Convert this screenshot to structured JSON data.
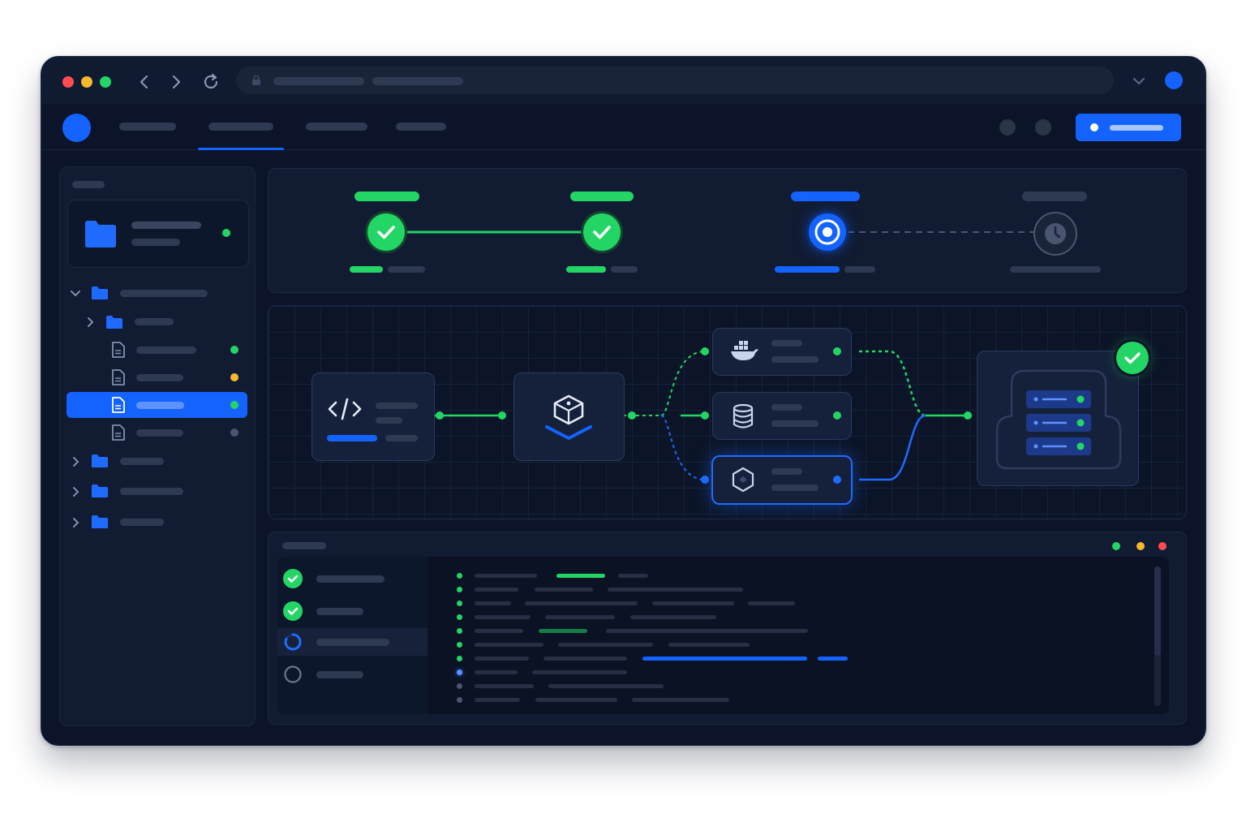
{
  "app": {
    "window_controls": [
      "close",
      "minimize",
      "maximize"
    ],
    "address_bar": {
      "icon": "lock-icon",
      "text": ""
    },
    "nav_tabs": [
      {
        "id": "nav-tab-1",
        "active": false
      },
      {
        "id": "nav-tab-2",
        "active": true
      },
      {
        "id": "nav-tab-3",
        "active": false
      },
      {
        "id": "nav-tab-4",
        "active": false
      }
    ],
    "primary_action": {
      "label": ""
    }
  },
  "sidebar": {
    "repo": {
      "name": "",
      "branch": "",
      "status": "ok"
    },
    "tree": [
      {
        "type": "folder",
        "expanded": true,
        "depth": 0
      },
      {
        "type": "folder",
        "expanded": false,
        "depth": 1
      },
      {
        "type": "file",
        "depth": 2,
        "status": "modified-green"
      },
      {
        "type": "file",
        "depth": 2,
        "status": "warning-yellow"
      },
      {
        "type": "file",
        "depth": 2,
        "status": "selected",
        "selected": true
      },
      {
        "type": "file",
        "depth": 2,
        "status": "neutral"
      },
      {
        "type": "folder",
        "expanded": false,
        "depth": 0
      },
      {
        "type": "folder",
        "expanded": false,
        "depth": 0
      },
      {
        "type": "folder",
        "expanded": false,
        "depth": 0
      }
    ]
  },
  "stages": [
    {
      "status": "success",
      "icon": "check-icon"
    },
    {
      "status": "success",
      "icon": "check-icon"
    },
    {
      "status": "running",
      "icon": "progress-icon"
    },
    {
      "status": "pending",
      "icon": "clock-icon"
    }
  ],
  "pipeline": {
    "nodes": [
      {
        "id": "source",
        "icon": "code-icon",
        "status": "done"
      },
      {
        "id": "build",
        "icon": "package-icon",
        "status": "done"
      },
      {
        "id": "docker",
        "icon": "docker-icon",
        "status": "done"
      },
      {
        "id": "database",
        "icon": "database-icon",
        "status": "done"
      },
      {
        "id": "deploy-target",
        "icon": "hexagon-icon",
        "status": "running"
      },
      {
        "id": "servers",
        "icon": "server-stack-icon",
        "status": "success"
      }
    ]
  },
  "logs": {
    "steps": [
      {
        "status": "success",
        "icon": "check-icon"
      },
      {
        "status": "success",
        "icon": "check-icon"
      },
      {
        "status": "running",
        "icon": "spinner-icon"
      },
      {
        "status": "pending",
        "icon": "circle-icon"
      }
    ],
    "window_dots": [
      "#22d565",
      "#f5b82e",
      "#ff4d4f"
    ]
  },
  "colors": {
    "accent": "#1463ff",
    "success": "#22d565",
    "warning": "#f5b82e",
    "error": "#ff4d4f",
    "background": "#0b1428",
    "panel": "#111b31"
  }
}
